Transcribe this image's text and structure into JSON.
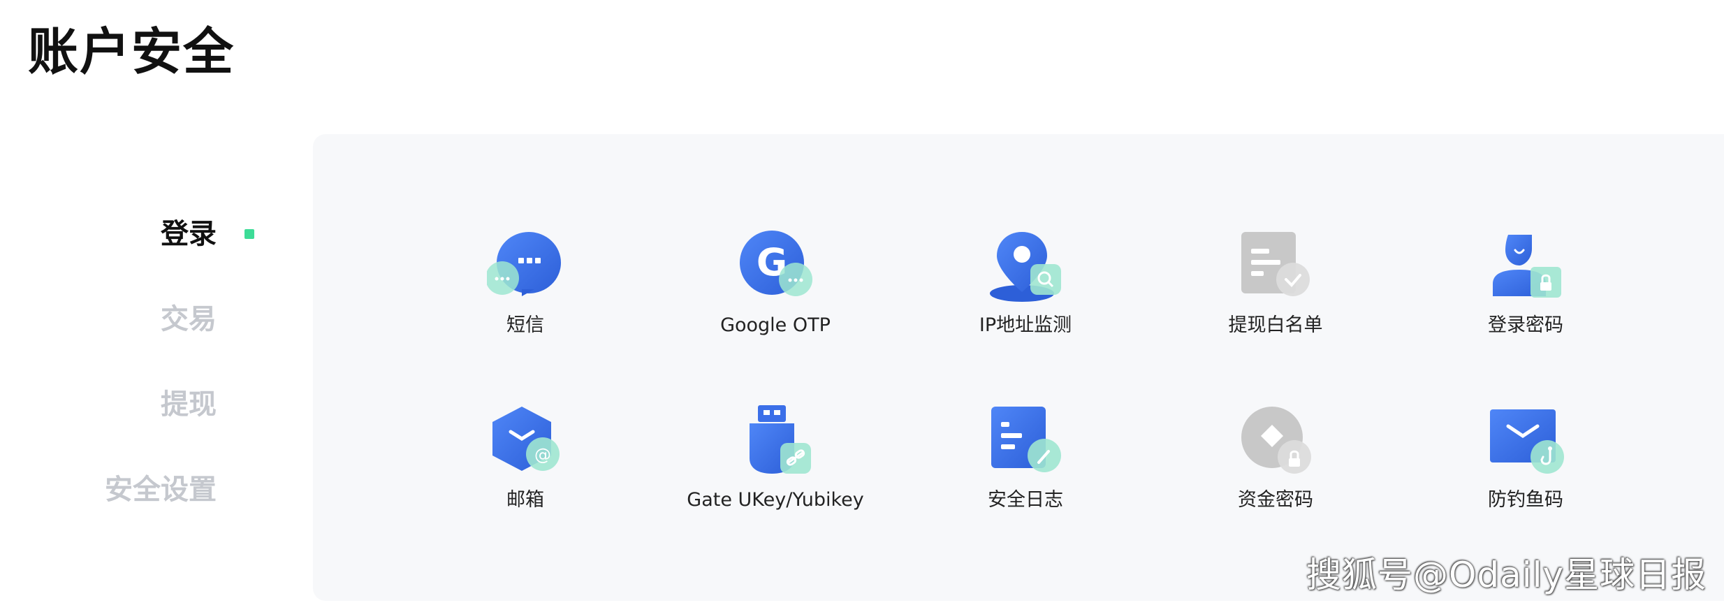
{
  "page": {
    "title": "账户安全"
  },
  "sidebar": {
    "items": [
      {
        "label": "登录",
        "active": true
      },
      {
        "label": "交易",
        "active": false
      },
      {
        "label": "提现",
        "active": false
      },
      {
        "label": "安全设置",
        "active": false
      }
    ]
  },
  "features": {
    "row1": [
      {
        "label": "短信",
        "icon": "chat-bubble-icon"
      },
      {
        "label": "Google OTP",
        "icon": "google-icon"
      },
      {
        "label": "IP地址监测",
        "icon": "location-pin-icon"
      },
      {
        "label": "提现白名单",
        "icon": "whitelist-doc-icon"
      },
      {
        "label": "登录密码",
        "icon": "user-lock-icon"
      }
    ],
    "row2": [
      {
        "label": "邮箱",
        "icon": "email-box-icon"
      },
      {
        "label": "Gate UKey/Yubikey",
        "icon": "usb-key-icon"
      },
      {
        "label": "安全日志",
        "icon": "log-document-icon"
      },
      {
        "label": "资金密码",
        "icon": "fund-lock-icon"
      },
      {
        "label": "防钓鱼码",
        "icon": "anti-phishing-mail-icon"
      }
    ]
  },
  "watermark": {
    "text": "搜狐号@Odaily星球日报"
  },
  "colors": {
    "accent_blue": "#3b6fe8",
    "accent_green": "#3ddc97",
    "disabled_gray": "#c9c9c9",
    "panel_bg": "#f7f8fa"
  }
}
